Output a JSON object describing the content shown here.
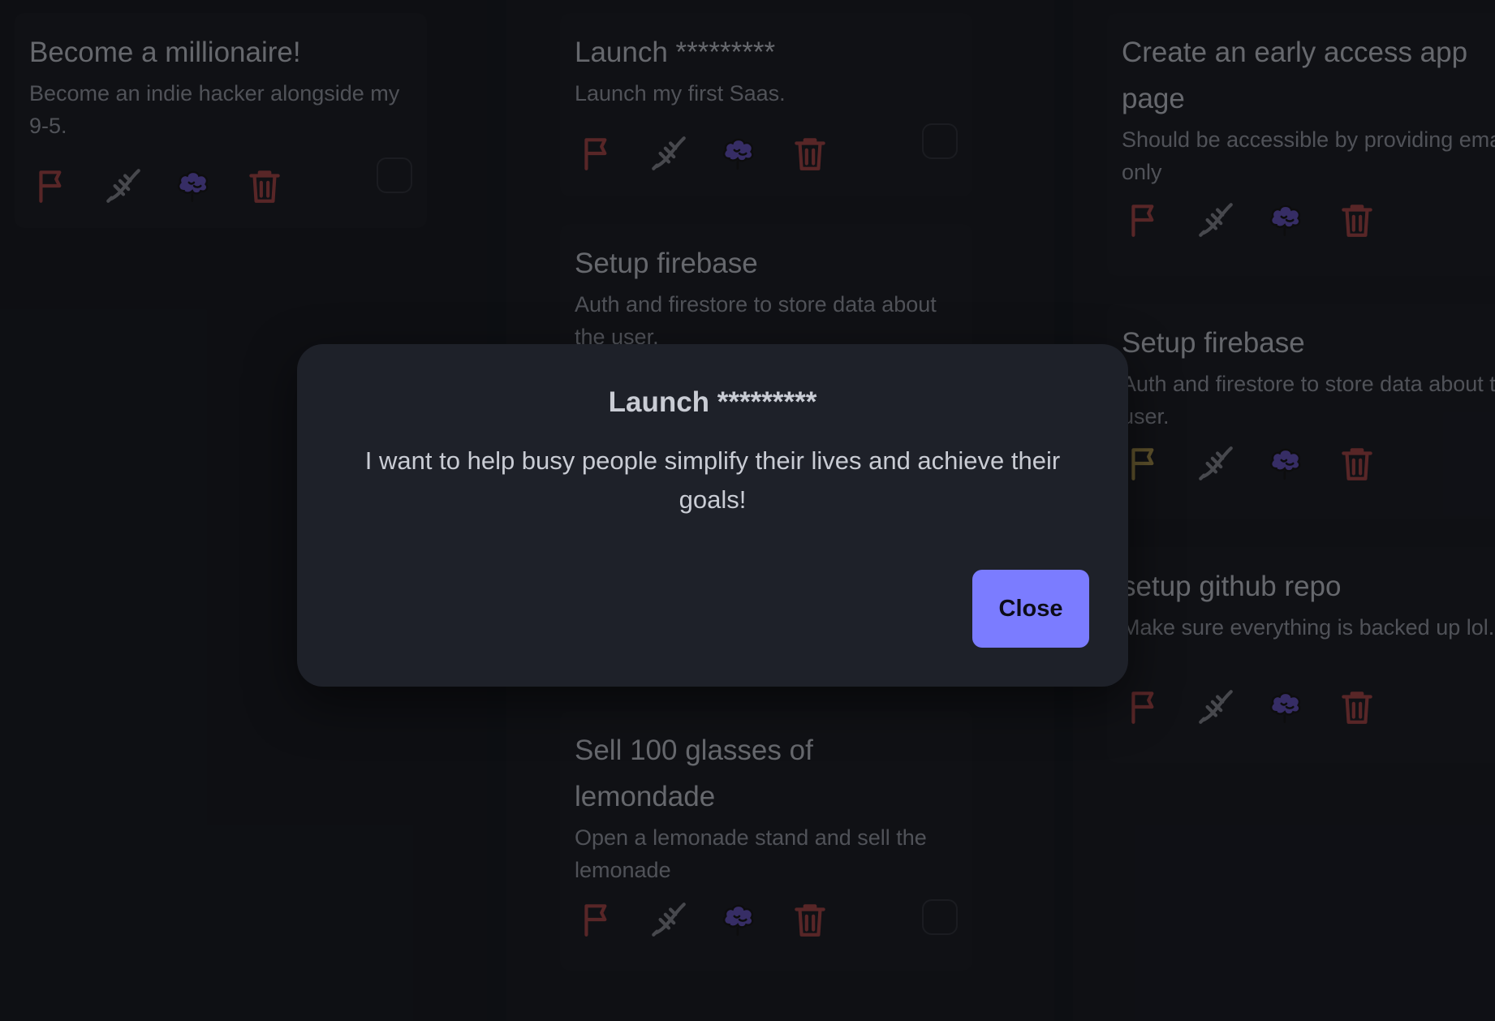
{
  "columns": [
    {
      "cards": [
        {
          "title": "Become a millionaire!",
          "desc": "Become an indie hacker alongside my 9-5.",
          "flag_color": "#9a3e3e"
        }
      ]
    },
    {
      "cards": [
        {
          "title": "Launch *********",
          "desc": "Launch my first Saas.",
          "flag_color": "#9a3e3e"
        },
        {
          "title": "Setup firebase",
          "desc": "Auth and firestore to store data about the user."
        },
        {
          "title": "Sell 100 glasses of lemondade",
          "desc": "Open a lemonade stand and sell the lemonade",
          "flag_color": "#9a3e3e"
        }
      ]
    },
    {
      "cards": [
        {
          "title": "Create an early access app page",
          "desc": "Should be accessible by providing email only",
          "flag_color": "#9a3e3e"
        },
        {
          "title": "Setup firebase",
          "desc": "Auth and firestore to store data about the user.",
          "flag_color": "#a08a45"
        },
        {
          "title": "setup github repo",
          "desc": "Make sure everything is backed up lol.",
          "flag_color": "#9a3e3e"
        }
      ]
    }
  ],
  "icons": {
    "flag": "flag-icon",
    "dna": "dna-icon",
    "brain": "brain-icon",
    "trash": "trash-icon"
  },
  "colors": {
    "dna": "#7a7d84",
    "brain": "#5b4bb0",
    "trash": "#9a3e3e",
    "accent": "#7b7cff"
  },
  "modal": {
    "title": "Launch *********",
    "body": "I want to help busy people simplify their lives and achieve their goals!",
    "close_label": "Close"
  }
}
